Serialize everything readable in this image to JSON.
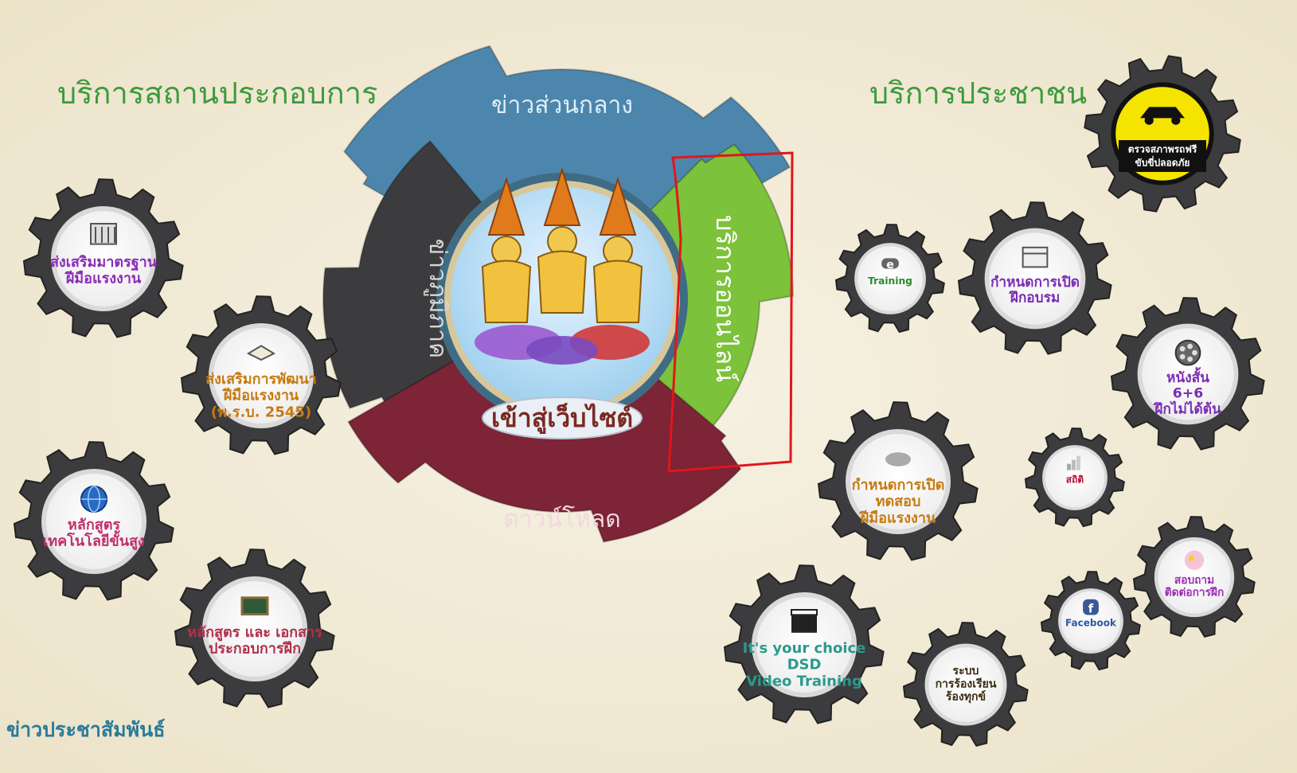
{
  "left_section": {
    "title": "บริการสถานประกอบการ",
    "news_link": "ข่าวประชาสัมพันธ์",
    "gears": [
      {
        "lines": [
          "ส่งเสริมมาตรฐาน",
          "ฝีมือแรงงาน"
        ],
        "icon": "building-chart-icon",
        "color": "#8a2db5"
      },
      {
        "lines": [
          "ส่งเสริมการพัฒนา",
          "ฝีมือแรงงาน",
          "(พ.ร.บ. 2545)"
        ],
        "icon": "book-icon",
        "color": "#c77a10"
      },
      {
        "lines": [
          "หลักสูตร",
          "เทคโนโลยีขั้นสูง"
        ],
        "icon": "globe-icon",
        "color": "#c0306a"
      },
      {
        "lines": [
          "หลักสูตร และ เอกสาร",
          "ประกอบการฝึก"
        ],
        "icon": "chalkboard-icon",
        "color": "#b0304a"
      }
    ]
  },
  "center": {
    "top": "ข่าวส่วนกลาง",
    "left": "ข่าวภูมิภาค",
    "right": "บริการออนไลน์",
    "bottom": "ดาวน์โหลด",
    "enter": "เข้าสู่เว็บไซต์"
  },
  "right_section": {
    "title": "บริการประชาชน",
    "badge": {
      "line1": "ตรวจสภาพรถฟรี",
      "line2": "ขับขี่ปลอดภัย",
      "icon": "car-wrench-icon"
    },
    "gears": [
      {
        "lines": [
          "Training"
        ],
        "icon": "e-letter-icon",
        "color": "#2a8a2a"
      },
      {
        "lines": [
          "กำหนดการเปิด",
          "ฝึกอบรม"
        ],
        "icon": "calendar-icon",
        "color": "#7a2db5"
      },
      {
        "lines": [
          "หนังสั้น",
          "6+6",
          "ฝึกไม่ได้ต้น"
        ],
        "icon": "film-reel-icon",
        "color": "#7a2db5"
      },
      {
        "lines": [
          "กำหนดการเปิด",
          "ทดสอบ",
          "ฝีมือแรงงาน"
        ],
        "icon": "cloud-tools-icon",
        "color": "#c77a10"
      },
      {
        "lines": [
          "สถิติ"
        ],
        "icon": "bar-chart-icon",
        "color": "#b01030"
      },
      {
        "lines": [
          "สอบถาม",
          "ติดต่อการฝึก"
        ],
        "icon": "flower-photo-icon",
        "color": "#9a2db5"
      },
      {
        "lines": [
          "Facebook"
        ],
        "icon": "facebook-icon",
        "color": "#2a5aa0"
      },
      {
        "lines": [
          "ระบบ",
          "การร้องเรียน",
          "ร้องทุกข์"
        ],
        "icon": "",
        "color": "#3a2a10"
      },
      {
        "lines": [
          "It's your choice",
          "DSD",
          "Video Training"
        ],
        "icon": "clapperboard-icon",
        "color": "#2a9a8a"
      }
    ]
  },
  "colors": {
    "gear_dark": "#3c3c3e",
    "gear_blue": "#4d86ad",
    "gear_green": "#7cc23a",
    "gear_red": "#7d2437",
    "title_green": "#3d9a3d",
    "highlight": "#e0161c"
  }
}
